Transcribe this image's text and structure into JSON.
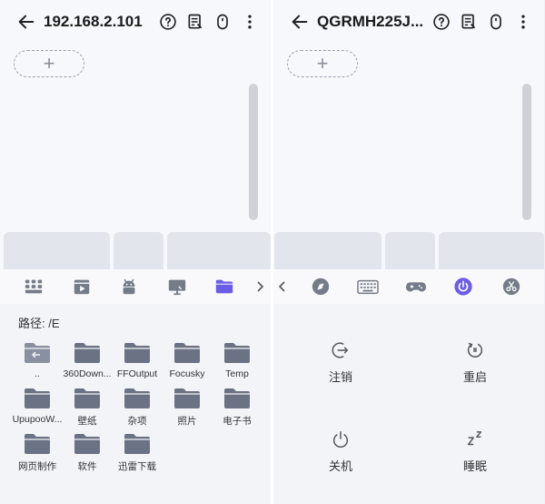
{
  "left": {
    "title": "192.168.2.101",
    "add_label": "+",
    "path_label": "路径: /E",
    "folders": [
      {
        "name": ".."
      },
      {
        "name": "360Down..."
      },
      {
        "name": "FFOutput"
      },
      {
        "name": "Focusky"
      },
      {
        "name": "Temp"
      },
      {
        "name": "UpupooW..."
      },
      {
        "name": "壁纸"
      },
      {
        "name": "杂项"
      },
      {
        "name": "照片"
      },
      {
        "name": "电子书"
      },
      {
        "name": "网页制作"
      },
      {
        "name": "软件"
      },
      {
        "name": "迅雷下载"
      }
    ],
    "tabs": [
      "keyboard-grid-icon",
      "video-icon",
      "android-icon",
      "screen-share-icon",
      "folder-icon"
    ],
    "active_tab": "folder-icon"
  },
  "right": {
    "title": "QGRMH225J...",
    "add_label": "+",
    "tabs": [
      "compass-icon",
      "keyboard-icon",
      "gamepad-icon",
      "power-icon",
      "scissors-icon"
    ],
    "active_tab": "power-icon",
    "power_actions": [
      {
        "label": "注销",
        "icon": "logout-icon"
      },
      {
        "label": "重启",
        "icon": "restart-icon"
      },
      {
        "label": "关机",
        "icon": "shutdown-icon"
      },
      {
        "label": "睡眠",
        "icon": "sleep-icon"
      }
    ]
  },
  "colors": {
    "accent": "#6c5ce7",
    "folder": "#6b7283",
    "icon": "#757b87"
  }
}
